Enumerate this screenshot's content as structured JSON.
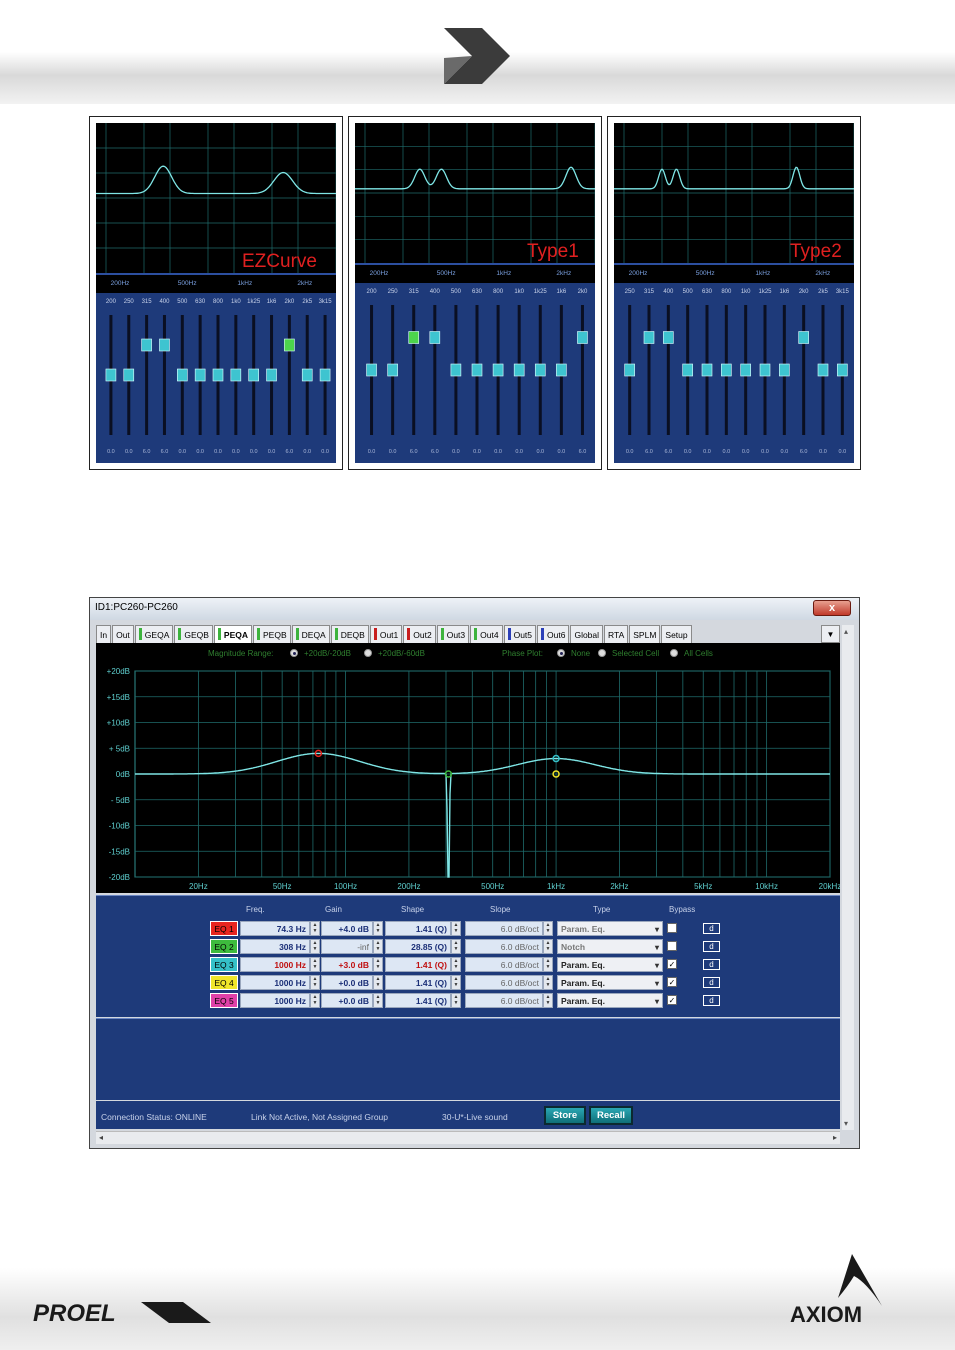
{
  "panels": [
    {
      "label": "EZCurve",
      "freq_ticks": [
        "200Hz",
        "500Hz",
        "1kHz",
        "2kHz"
      ],
      "bands": [
        "200",
        "250",
        "315",
        "400",
        "500",
        "630",
        "800",
        "1k0",
        "1k25",
        "1k6",
        "2k0",
        "2k5",
        "3k15"
      ],
      "values": [
        "0.0",
        "0.0",
        "6.0",
        "6.0",
        "0.0",
        "0.0",
        "0.0",
        "0.0",
        "0.0",
        "0.0",
        "6.0",
        "0.0",
        "0.0"
      ]
    },
    {
      "label": "Type1",
      "freq_ticks": [
        "200Hz",
        "500Hz",
        "1kHz",
        "2kHz"
      ],
      "bands": [
        "200",
        "250",
        "315",
        "400",
        "500",
        "630",
        "800",
        "1k0",
        "1k25",
        "1k6",
        "2k0"
      ],
      "values": [
        "0.0",
        "0.0",
        "6.0",
        "6.0",
        "0.0",
        "0.0",
        "0.0",
        "0.0",
        "0.0",
        "0.0",
        "6.0"
      ]
    },
    {
      "label": "Type2",
      "freq_ticks": [
        "200Hz",
        "500Hz",
        "1kHz",
        "2kHz"
      ],
      "bands": [
        "250",
        "315",
        "400",
        "500",
        "630",
        "800",
        "1k0",
        "1k25",
        "1k6",
        "2k0",
        "2k5",
        "3k15"
      ],
      "values": [
        "0.0",
        "6.0",
        "6.0",
        "0.0",
        "0.0",
        "0.0",
        "0.0",
        "0.0",
        "0.0",
        "6.0",
        "0.0",
        "0.0"
      ]
    }
  ],
  "window": {
    "title": "ID1:PC260-PC260",
    "close_label": "x",
    "tabs": [
      {
        "label": "In",
        "color": ""
      },
      {
        "label": "Out",
        "color": ""
      },
      {
        "label": "GEQA",
        "color": "#3db33d"
      },
      {
        "label": "GEQB",
        "color": "#3db33d"
      },
      {
        "label": "PEQA",
        "color": "#3db33d",
        "active": true
      },
      {
        "label": "PEQB",
        "color": "#3db33d"
      },
      {
        "label": "DEQA",
        "color": "#3db33d"
      },
      {
        "label": "DEQB",
        "color": "#3db33d"
      },
      {
        "label": "Out1",
        "color": "#c81e1e"
      },
      {
        "label": "Out2",
        "color": "#c81e1e"
      },
      {
        "label": "Out3",
        "color": "#3db33d"
      },
      {
        "label": "Out4",
        "color": "#3db33d"
      },
      {
        "label": "Out5",
        "color": "#2b3fb8"
      },
      {
        "label": "Out6",
        "color": "#2b3fb8"
      },
      {
        "label": "Global",
        "color": ""
      },
      {
        "label": "RTA",
        "color": ""
      },
      {
        "label": "SPLM",
        "color": ""
      },
      {
        "label": "Setup",
        "color": ""
      }
    ],
    "tab_menu": "▼",
    "options": {
      "magnitude_label": "Magnitude Range:",
      "mag_opt1": "+20dB/-20dB",
      "mag_opt2": "+20dB/-60dB",
      "phase_label": "Phase Plot:",
      "phase_opt1": "None",
      "phase_opt2": "Selected Cell",
      "phase_opt3": "All Cells"
    },
    "graph": {
      "y_ticks": [
        "+20dB",
        "+15dB",
        "+10dB",
        "+ 5dB",
        "0dB",
        "- 5dB",
        "-10dB",
        "-15dB",
        "-20dB"
      ],
      "x_ticks": [
        "20Hz",
        "50Hz",
        "100Hz",
        "200Hz",
        "500Hz",
        "1kHz",
        "2kHz",
        "5kHz",
        "10kHz",
        "20kHz"
      ]
    },
    "headers": {
      "freq": "Freq.",
      "gain": "Gain",
      "shape": "Shape",
      "slope": "Slope",
      "type": "Type",
      "bypass": "Bypass"
    },
    "eq_rows": [
      {
        "label": "EQ 1",
        "color": "#e8251f",
        "freq": "74.3 Hz",
        "gain": "+4.0 dB",
        "shape": "1.41 (Q)",
        "slope": "6.0 dB/oct",
        "type": "Param. Eq.",
        "bypass": "",
        "d": "d"
      },
      {
        "label": "EQ 2",
        "color": "#3dbb3d",
        "freq": "308 Hz",
        "gain": "-inf",
        "shape": "28.85 (Q)",
        "slope": "6.0 dB/oct",
        "type": "Notch",
        "bypass": "",
        "d": "d"
      },
      {
        "label": "EQ 3",
        "color": "#35c0c8",
        "freq": "1000 Hz",
        "gain": "+3.0 dB",
        "shape": "1.41 (Q)",
        "slope": "6.0 dB/oct",
        "type": "Param. Eq.",
        "bypass": "✓",
        "d": "d"
      },
      {
        "label": "EQ 4",
        "color": "#f0e62a",
        "freq": "1000 Hz",
        "gain": "+0.0 dB",
        "shape": "1.41 (Q)",
        "slope": "6.0 dB/oct",
        "type": "Param. Eq.",
        "bypass": "✓",
        "d": "d"
      },
      {
        "label": "EQ 5",
        "color": "#e040a8",
        "freq": "1000 Hz",
        "gain": "+0.0 dB",
        "shape": "1.41 (Q)",
        "slope": "6.0 dB/oct",
        "type": "Param. Eq.",
        "bypass": "✓",
        "d": "d"
      }
    ],
    "status": {
      "connection": "Connection Status: ONLINE",
      "link": "Link Not Active,  Not Assigned Group",
      "preset": "30-U*-Live sound",
      "store": "Store",
      "recall": "Recall"
    }
  },
  "brands": {
    "left": "PROEL",
    "right": "AXIOM"
  },
  "colors": {
    "curve": "#7fe6e6",
    "grid": "#1f6b6b",
    "panel_blue": "#1e3a7a",
    "label_red": "#e02020"
  }
}
